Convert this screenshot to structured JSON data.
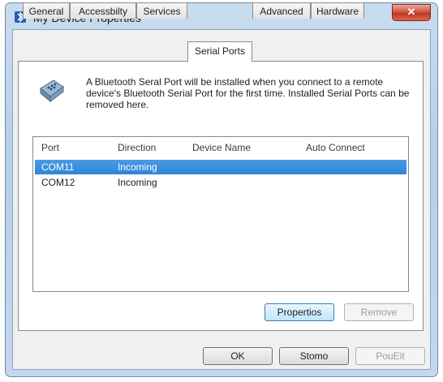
{
  "window": {
    "title": "My Device Properties",
    "close_glyph": "✕"
  },
  "tabs": [
    {
      "label": "General"
    },
    {
      "label": "Accessbilty"
    },
    {
      "label": "Services"
    },
    {
      "label": "Serial Ports"
    },
    {
      "label": "Advanced"
    },
    {
      "label": "Hardware"
    }
  ],
  "active_tab": "Serial Ports",
  "info": {
    "icon": "serial-port-icon",
    "text": "A Bluetooth Seral Port will be installed when you connect to a remote device's Bluetooth Serial Port for the first time. Installed Serial Ports can be removed here."
  },
  "list": {
    "columns": [
      "Port",
      "Direction",
      "Device Name",
      "Auto Connect"
    ],
    "rows": [
      {
        "port": "COM11",
        "direction": "Incoming",
        "device_name": "",
        "auto_connect": "",
        "selected": true
      },
      {
        "port": "COM12",
        "direction": "Incoming",
        "device_name": "",
        "auto_connect": "",
        "selected": false
      }
    ]
  },
  "buttons": {
    "properties": "Propertios",
    "remove": "Remove",
    "ok": "OK",
    "cancel": "Stomo",
    "apply": "PouEit"
  },
  "colors": {
    "selection": "#3a8fdf",
    "close": "#c8402a"
  }
}
